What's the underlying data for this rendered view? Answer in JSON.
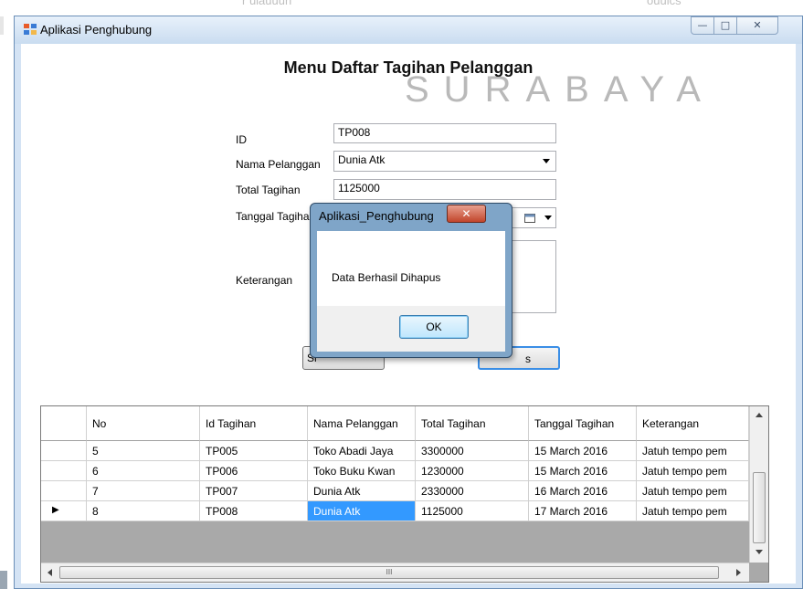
{
  "watermark": {
    "top_fragment_1": "r ulauuun",
    "top_fragment_2": "ouuics",
    "city": "SURABAYA"
  },
  "window": {
    "title": "Aplikasi Penghubung",
    "minimize_glyph": "—",
    "maximize_glyph": "□",
    "close_glyph": "✕"
  },
  "form": {
    "title": "Menu Daftar Tagihan Pelanggan",
    "id": {
      "label": "ID",
      "value": "TP008"
    },
    "nama_pelanggan": {
      "label": "Nama Pelanggan",
      "value": "Dunia Atk"
    },
    "total_tagihan": {
      "label": "Total Tagihan",
      "value": "1125000"
    },
    "tanggal_tagihan": {
      "label": "Tanggal Tagihan"
    },
    "keterangan": {
      "label": "Keterangan"
    },
    "button_left_partial": "Si",
    "button_right_partial": "s"
  },
  "grid": {
    "columns": [
      "No",
      "Id Tagihan",
      "Nama Pelanggan",
      "Total Tagihan",
      "Tanggal Tagihan",
      "Keterangan"
    ],
    "rows": [
      [
        "5",
        "TP005",
        "Toko Abadi Jaya",
        "3300000",
        "15 March 2016",
        "Jatuh tempo pem"
      ],
      [
        "6",
        "TP006",
        "Toko Buku Kwan",
        "1230000",
        "15 March 2016",
        "Jatuh tempo pem"
      ],
      [
        "7",
        "TP007",
        "Dunia Atk",
        "2330000",
        "16 March 2016",
        "Jatuh tempo pem"
      ],
      [
        "8",
        "TP008",
        "Dunia Atk",
        "1125000",
        "17 March 2016",
        "Jatuh tempo pem"
      ]
    ],
    "current_row_marker": "▶",
    "hscroll_thumb_glyph": "III"
  },
  "dialog": {
    "title": "Aplikasi_Penghubung",
    "message": "Data Berhasil Dihapus",
    "ok_label": "OK",
    "close_glyph": "✕"
  },
  "colors": {
    "window_frame": "#d4e3f4",
    "selection": "#3399ff",
    "dialog_close": "#c2452b"
  }
}
